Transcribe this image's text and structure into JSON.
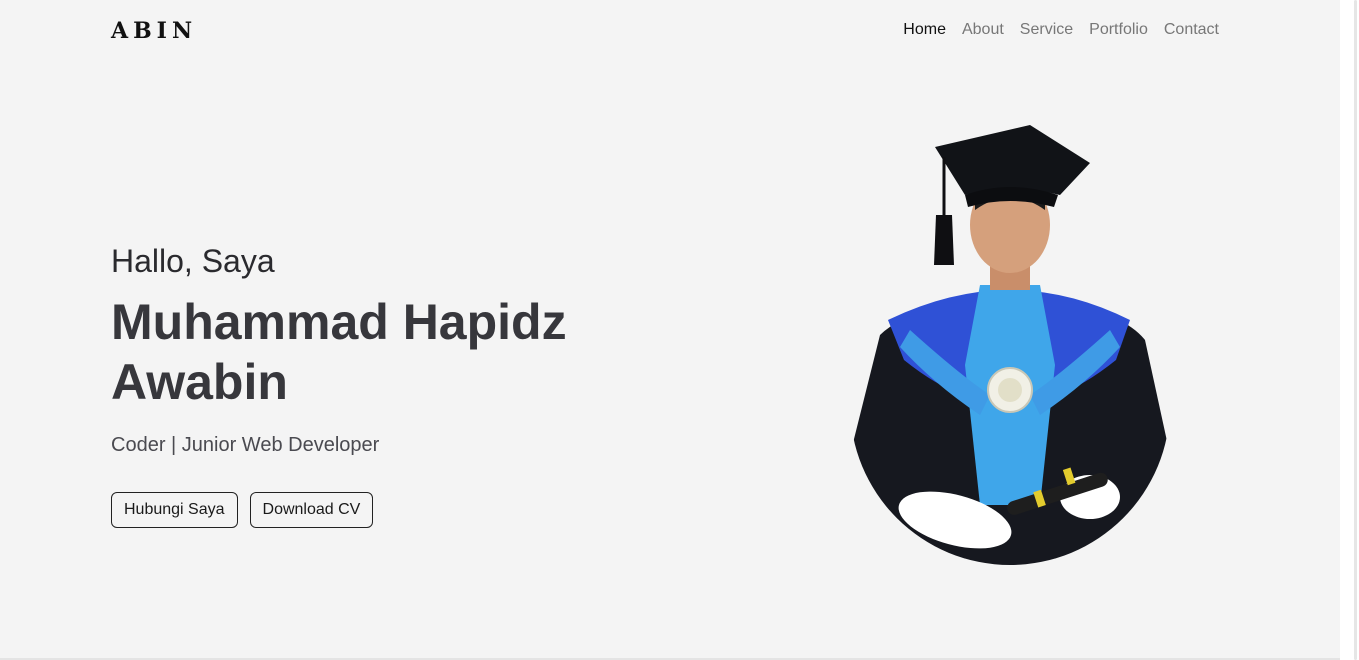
{
  "brand": {
    "name": "ABIN"
  },
  "nav": {
    "items": [
      {
        "label": "Home",
        "active": true
      },
      {
        "label": "About",
        "active": false
      },
      {
        "label": "Service",
        "active": false
      },
      {
        "label": "Portfolio",
        "active": false
      },
      {
        "label": "Contact",
        "active": false
      }
    ]
  },
  "hero": {
    "greeting": "Hallo, Saya",
    "name_line1": "Muhammad Hapidz",
    "name_line2": "Awabin",
    "role": "Coder | Junior Web Developer",
    "contact_button": "Hubungi Saya",
    "cv_button": "Download CV"
  },
  "colors": {
    "background": "#f4f4f4",
    "heading": "#37373c",
    "nav_inactive": "#777777",
    "nav_active": "#111111",
    "gown": "#16181f",
    "stole": "#3fa6ea",
    "collar": "#2f51d6"
  }
}
